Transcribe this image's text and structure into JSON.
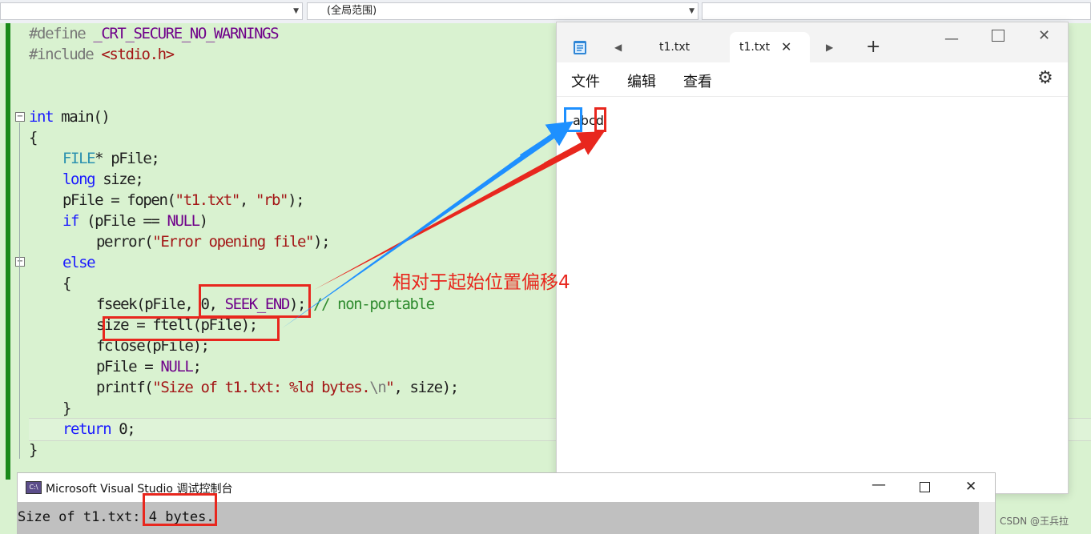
{
  "scopebar": {
    "scope": "(全局范围)"
  },
  "code": {
    "l1_a": "#define ",
    "l1_b": "_CRT_SECURE_NO_WARNINGS",
    "l2_a": "#include ",
    "l2_b": "<stdio.h>",
    "l3_a": "int",
    "l3_b": " main()",
    "l4": "{",
    "l5_a": "FILE",
    "l5_b": "* pFile;",
    "l6_a": "long",
    "l6_b": " size;",
    "l7_a": "pFile = fopen(",
    "l7_b": "\"t1.txt\"",
    "l7_c": ", ",
    "l7_d": "\"rb\"",
    "l7_e": ");",
    "l8_a": "if",
    "l8_b": " (pFile == ",
    "l8_c": "NULL",
    "l8_d": ")",
    "l9_a": "perror(",
    "l9_b": "\"Error opening file\"",
    "l9_c": ");",
    "l10": "else",
    "l11": "{",
    "l12_a": "fseek(pFile, 0, ",
    "l12_b": "SEEK_END",
    "l12_c": "); ",
    "l12_d": "// non-portable",
    "l13": "size = ftell(pFile);",
    "l14": "fclose(pFile);",
    "l15_a": "pFile = ",
    "l15_b": "NULL",
    "l15_c": ";",
    "l16_a": "printf(",
    "l16_b": "\"Size of t1.txt: %ld bytes.",
    "l16_c": "\\n",
    "l16_d": "\"",
    "l16_e": ", size);",
    "l17": "}",
    "l18_a": "return",
    "l18_b": " 0;",
    "l19": "}"
  },
  "notepad": {
    "tabs": [
      "t1.txt",
      "t1.txt"
    ],
    "menu": [
      "文件",
      "编辑",
      "查看"
    ],
    "content": "abcd"
  },
  "annotation": "相对于起始位置偏移4",
  "console": {
    "title": "Microsoft Visual Studio 调试控制台",
    "output": "Size of t1.txt: 4 bytes."
  },
  "colors": {
    "annotation_red": "#e8271e",
    "annotation_blue": "#1e90ff",
    "editor_bg": "#d9f2d0"
  },
  "watermark": "CSDN @王兵拉"
}
